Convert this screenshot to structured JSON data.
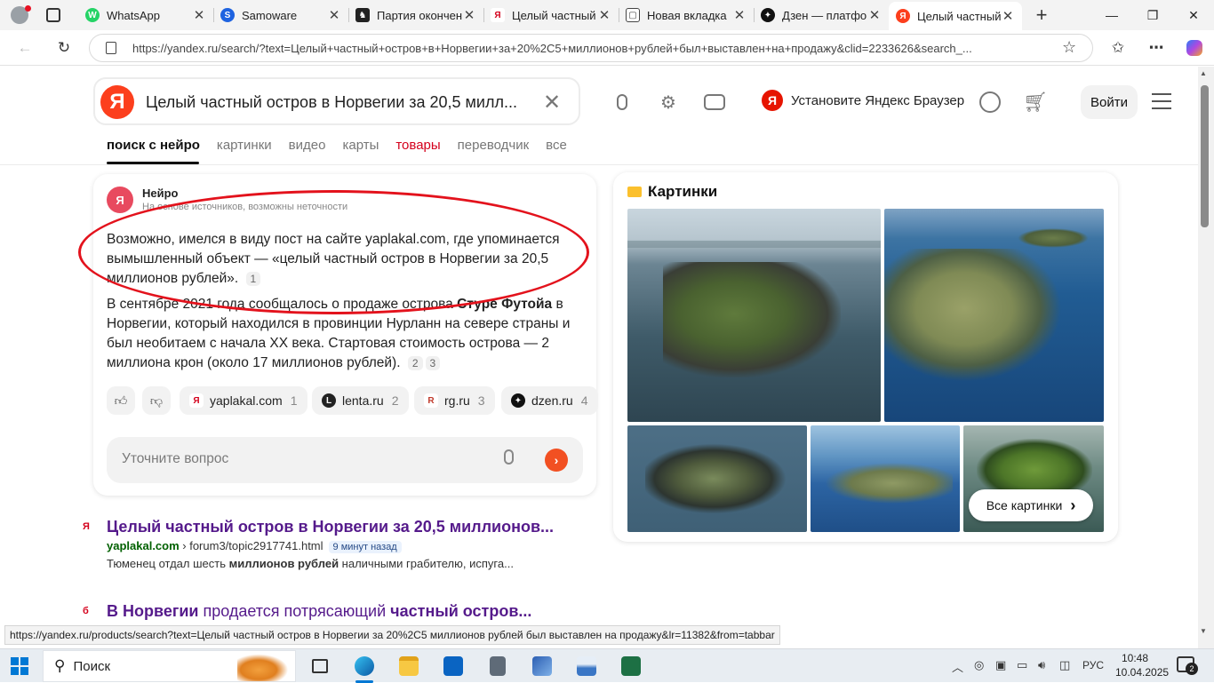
{
  "browser": {
    "tabs": [
      {
        "title": "WhatsApp",
        "icon": "whatsapp-icon",
        "color": "#25d366",
        "glyph": "W"
      },
      {
        "title": "Samoware",
        "icon": "samoware-icon",
        "color": "#1e63e0",
        "glyph": "S"
      },
      {
        "title": "Партия окончен",
        "icon": "chess-icon",
        "color": "#222222",
        "glyph": "♞"
      },
      {
        "title": "Целый частный",
        "icon": "yaplakal-icon",
        "color": "#d4001c",
        "glyph": "Я"
      },
      {
        "title": "Новая вкладка",
        "icon": "new-tab-icon",
        "color": "#555555",
        "glyph": "▢"
      },
      {
        "title": "Дзен — платфор",
        "icon": "dzen-icon",
        "color": "#111111",
        "glyph": "✦"
      },
      {
        "title": "Целый частный",
        "icon": "yandex-icon",
        "color": "#fc3f1d",
        "glyph": "Я"
      }
    ],
    "url": "https://yandex.ru/search/?text=Целый+частный+остров+в+Норвегии+за+20%2C5+миллионов+рублей+был+выставлен+на+продажу&clid=2233626&search_..."
  },
  "search": {
    "query": "Целый частный остров в Норвегии за 20,5 милл...",
    "install_label": "Установите Яндекс Браузер",
    "login_label": "Войти",
    "nav": [
      "поиск с нейро",
      "картинки",
      "видео",
      "карты",
      "товары",
      "переводчик",
      "все"
    ]
  },
  "neuro": {
    "title": "Нейро",
    "subtitle": "На основе источников, возможны неточности",
    "para1": "Возможно, имелся в виду пост на сайте yaplakal.com, где упоминается вымышленный объект — «целый частный остров в Норвегии за 20,5 миллионов рублей».",
    "para1_ref": "1",
    "para2_a": "В сентябре 2021 года сообщалось о продаже острова ",
    "para2_bold": "Стуре Футойа",
    "para2_b": " в Норвегии, который находился в провинции Нурланн на севере страны и был необитаем с начала XX века. Стартовая стоимость острова — 2 миллиона крон (около 17 миллионов рублей).",
    "para2_refs": [
      "2",
      "3"
    ],
    "sources": [
      {
        "name": "yaplakal.com",
        "num": "1",
        "color": "#d4001c",
        "glyph": "Я"
      },
      {
        "name": "lenta.ru",
        "num": "2",
        "color": "#222222",
        "glyph": "L"
      },
      {
        "name": "rg.ru",
        "num": "3",
        "color": "#c0392b",
        "glyph": "R"
      },
      {
        "name": "dzen.ru",
        "num": "4",
        "color": "#111111",
        "glyph": "✦"
      }
    ],
    "ask_placeholder": "Уточните вопрос"
  },
  "images": {
    "title": "Картинки",
    "all_label": "Все картинки"
  },
  "results": [
    {
      "title": "Целый частный остров в Норвегии за 20,5 миллионов...",
      "domain": "yaplakal.com",
      "path": " › forum3/topic2917741.html",
      "time": "9 минут назад",
      "snippet_a": "Тюменец отдал шесть ",
      "snippet_b": "миллионов рублей",
      "snippet_c": " наличными грабителю, испуга..."
    },
    {
      "title_a": "В Норвегии",
      "title_b": " продается потрясающий ",
      "title_c": "частный остров..."
    }
  ],
  "status_url": "https://yandex.ru/products/search?text=Целый частный остров в Норвегии за 20%2C5 миллионов рублей был выставлен на продажу&lr=11382&from=tabbar",
  "taskbar": {
    "search_label": "Поиск",
    "lang": "РУС",
    "time": "10:48",
    "date": "10.04.2025",
    "notifications": "2"
  }
}
